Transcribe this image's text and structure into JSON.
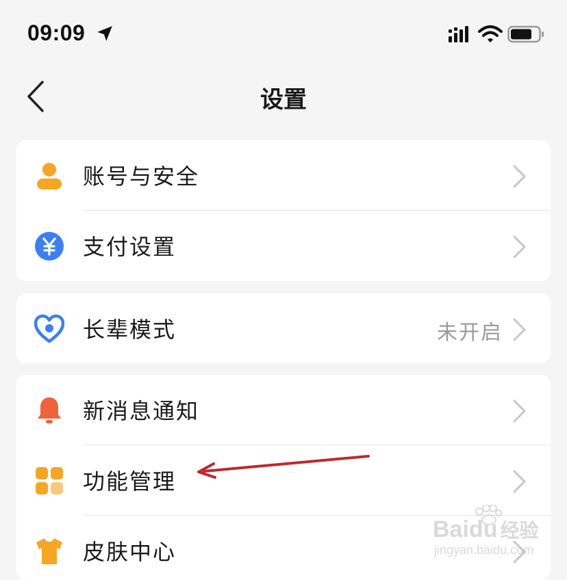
{
  "status_bar": {
    "time": "09:09"
  },
  "nav": {
    "title": "设置",
    "back_icon": "chevron-left-icon"
  },
  "groups": [
    {
      "items": [
        {
          "label": "账号与安全",
          "value": "",
          "icon": "person-icon",
          "icon_color": "#f5a623"
        },
        {
          "label": "支付设置",
          "value": "",
          "icon": "yuan-icon",
          "icon_color": "#3b7ff2"
        }
      ]
    },
    {
      "items": [
        {
          "label": "长辈模式",
          "value": "未开启",
          "icon": "heart-person-icon",
          "icon_color": "#3b7ff2"
        }
      ]
    },
    {
      "items": [
        {
          "label": "新消息通知",
          "value": "",
          "icon": "bell-icon",
          "icon_color": "#f0623a"
        },
        {
          "label": "功能管理",
          "value": "",
          "icon": "grid-icon",
          "icon_color": "#f5a623"
        },
        {
          "label": "皮肤中心",
          "value": "",
          "icon": "tshirt-icon",
          "icon_color": "#f5a623"
        }
      ]
    }
  ],
  "watermark": {
    "brand": "Bai",
    "brand2": "du",
    "cn": "经验",
    "url": "jingyan.baidu.com"
  },
  "colors": {
    "background": "#f5f5f5",
    "card": "#ffffff",
    "annotation": "#c0282a",
    "chevron": "#c7c7c7"
  }
}
